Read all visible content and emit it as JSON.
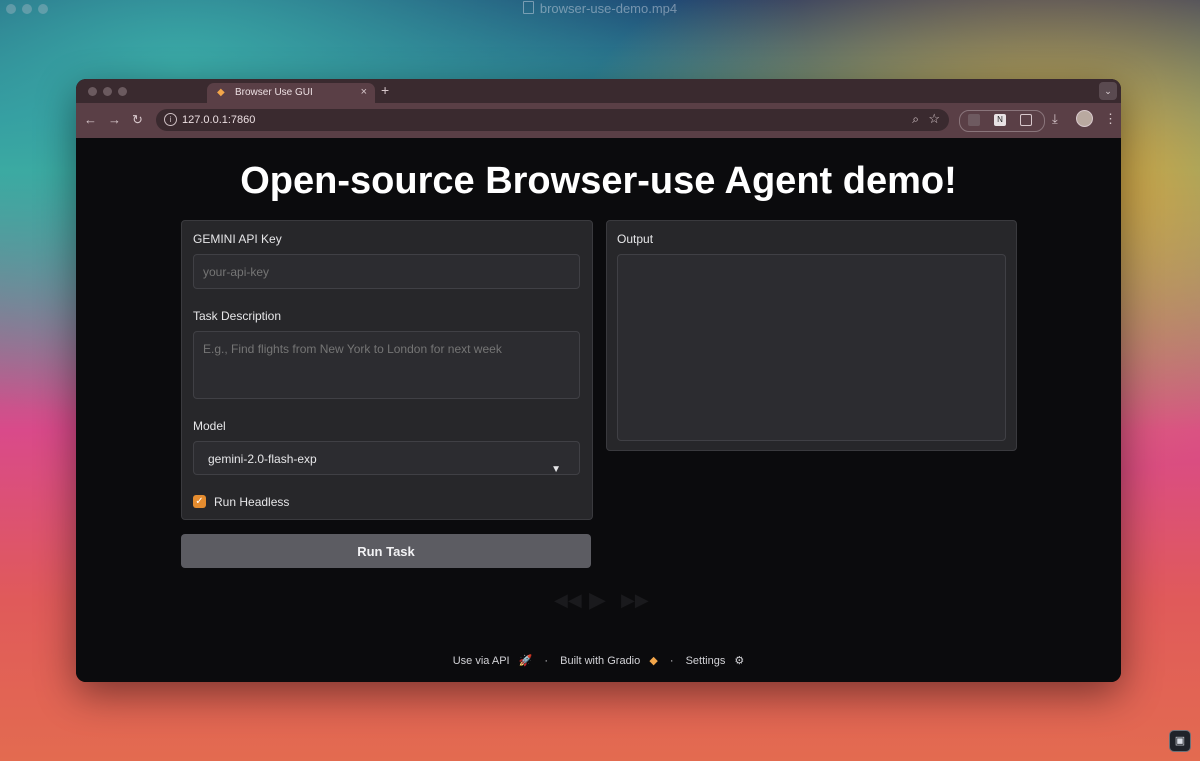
{
  "desktop": {
    "window_title": "browser-use-demo.mp4"
  },
  "browser": {
    "tab": {
      "title": "Browser Use GUI",
      "favicon": "gradio-logo-icon",
      "close": "×"
    },
    "new_tab": "+",
    "tab_menu": "⌄",
    "nav": {
      "back": "←",
      "forward": "→",
      "reload": "↻"
    },
    "url": "127.0.0.1:7860",
    "menu": "⋮"
  },
  "page": {
    "title": "Open-source Browser-use Agent demo!",
    "api_key": {
      "label": "GEMINI API Key",
      "value": "",
      "placeholder": "your-api-key"
    },
    "task": {
      "label": "Task Description",
      "value": "",
      "placeholder": "E.g., Find flights from New York to London for next week"
    },
    "model": {
      "label": "Model",
      "selected": "gemini-2.0-flash-exp"
    },
    "headless": {
      "label": "Run Headless",
      "checked": true
    },
    "run_button": "Run Task",
    "output": {
      "label": "Output",
      "value": ""
    },
    "footer": {
      "api": "Use via API",
      "api_icon": "🚀",
      "sep1": "·",
      "built": "Built with Gradio",
      "built_icon": "gradio-logo-icon",
      "sep2": "·",
      "settings": "Settings",
      "settings_icon": "⚙"
    }
  },
  "colors": {
    "accent": "#e58c2f",
    "page_bg": "#0b0b0d",
    "panel_bg": "#27272a",
    "tab_bar": "#3a2a2f",
    "toolbar": "#5a3f46"
  }
}
